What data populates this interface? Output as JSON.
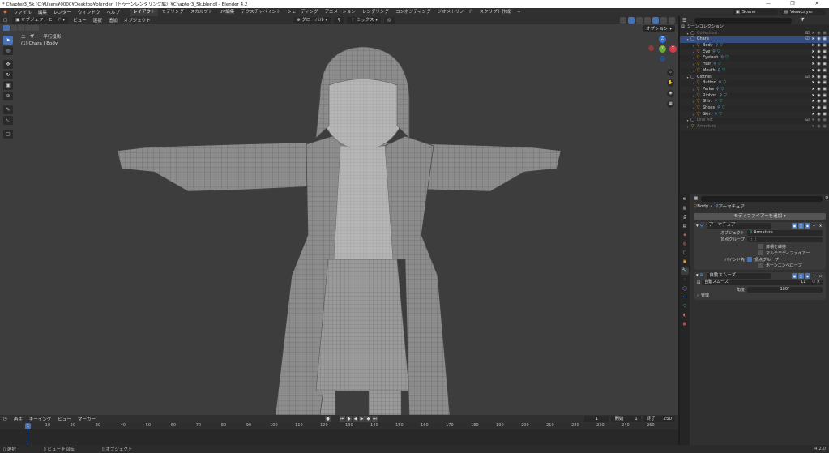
{
  "titlebar": {
    "title": "* Chapter3_5k [C:¥Users¥0000¥Desktop¥blender（トゥーンレンダリング編）¥Chapter3_5k.blend] - Blender 4.2",
    "minimize": "—",
    "maximize": "❐",
    "close": "✕"
  },
  "menu": {
    "items": [
      "ファイル",
      "編集",
      "レンダー",
      "ウィンドウ",
      "ヘルプ"
    ],
    "workspaces": [
      "レイアウト",
      "モデリング",
      "スカルプト",
      "UV編集",
      "テクスチャペイント",
      "シェーディング",
      "アニメーション",
      "レンダリング",
      "コンポジティング",
      "ジオメトリノード",
      "スクリプト作成"
    ],
    "active_workspace": "レイアウト",
    "add_workspace": "+",
    "scene": "Scene",
    "view_layer": "ViewLayer"
  },
  "viewport": {
    "header": {
      "editor_icon": "cube-icon",
      "mode": "オブジェクトモード",
      "menus": [
        "ビュー",
        "選択",
        "追加",
        "オブジェクト"
      ],
      "transform_orientation": "グローバル",
      "mix": "ミックス",
      "option": "オプション"
    },
    "info_line1": "ユーザー・平行投影",
    "info_line2": "(1) Chara | Body",
    "axis": {
      "x": "X",
      "y": "Y",
      "z": "Z"
    }
  },
  "timeline": {
    "menus": [
      "再生",
      "キーイング",
      "ビュー",
      "マーカー"
    ],
    "current_frame": "1",
    "start_label": "開始",
    "start": "1",
    "end_label": "終了",
    "end": "250",
    "playhead": "1",
    "ticks": [
      "10",
      "20",
      "30",
      "40",
      "50",
      "60",
      "70",
      "80",
      "90",
      "100",
      "110",
      "120",
      "130",
      "140",
      "150",
      "160",
      "170",
      "180",
      "190",
      "200",
      "210",
      "220",
      "230",
      "240",
      "250"
    ]
  },
  "status": {
    "select": "選択",
    "rotate": "ビューを回転",
    "object": "オブジェクト",
    "version": "4.2.0"
  },
  "outliner": {
    "root": "シーンコレクション",
    "rows": [
      {
        "name": "Collection",
        "level": 1,
        "type": "collection",
        "dim": true
      },
      {
        "name": "Chara",
        "level": 1,
        "type": "collection",
        "selected": true
      },
      {
        "name": "Body",
        "level": 2,
        "type": "object"
      },
      {
        "name": "Eye",
        "level": 2,
        "type": "object"
      },
      {
        "name": "Eyelash",
        "level": 2,
        "type": "object"
      },
      {
        "name": "Hair",
        "level": 2,
        "type": "object"
      },
      {
        "name": "Mouth",
        "level": 2,
        "type": "object"
      },
      {
        "name": "Clothes",
        "level": 1,
        "type": "collection"
      },
      {
        "name": "Button",
        "level": 2,
        "type": "object"
      },
      {
        "name": "Parka",
        "level": 2,
        "type": "object"
      },
      {
        "name": "Ribbon",
        "level": 2,
        "type": "object"
      },
      {
        "name": "Shirt",
        "level": 2,
        "type": "object"
      },
      {
        "name": "Shoes",
        "level": 2,
        "type": "object"
      },
      {
        "name": "Skirt",
        "level": 2,
        "type": "object"
      },
      {
        "name": "Line Art",
        "level": 1,
        "type": "collection",
        "dim": true
      },
      {
        "name": "Armature",
        "level": 1,
        "type": "object",
        "dim": true
      }
    ]
  },
  "properties": {
    "breadcrumb_object": "Body",
    "breadcrumb_sep": "›",
    "breadcrumb_modifier": "アーマチュア",
    "add_modifier": "モディファイアーを追加",
    "armature_modifier": {
      "name": "アーマチュア",
      "object_label": "オブジェクト",
      "object_value": "Armature",
      "vgroup_label": "頂点グループ",
      "preserve_volume": "体積を維持",
      "multi_modifier": "マルチモディファイアー",
      "bind_label": "バインド先",
      "bind_vgroups": "頂点グループ",
      "bind_envelopes": "ボーンエンベロープ"
    },
    "smooth_modifier": {
      "name": "自動スムーズ",
      "node_group": "自動スムーズ",
      "user_count": "11",
      "angle_label": "角度",
      "angle_value": "180°",
      "manage": "管理"
    }
  }
}
